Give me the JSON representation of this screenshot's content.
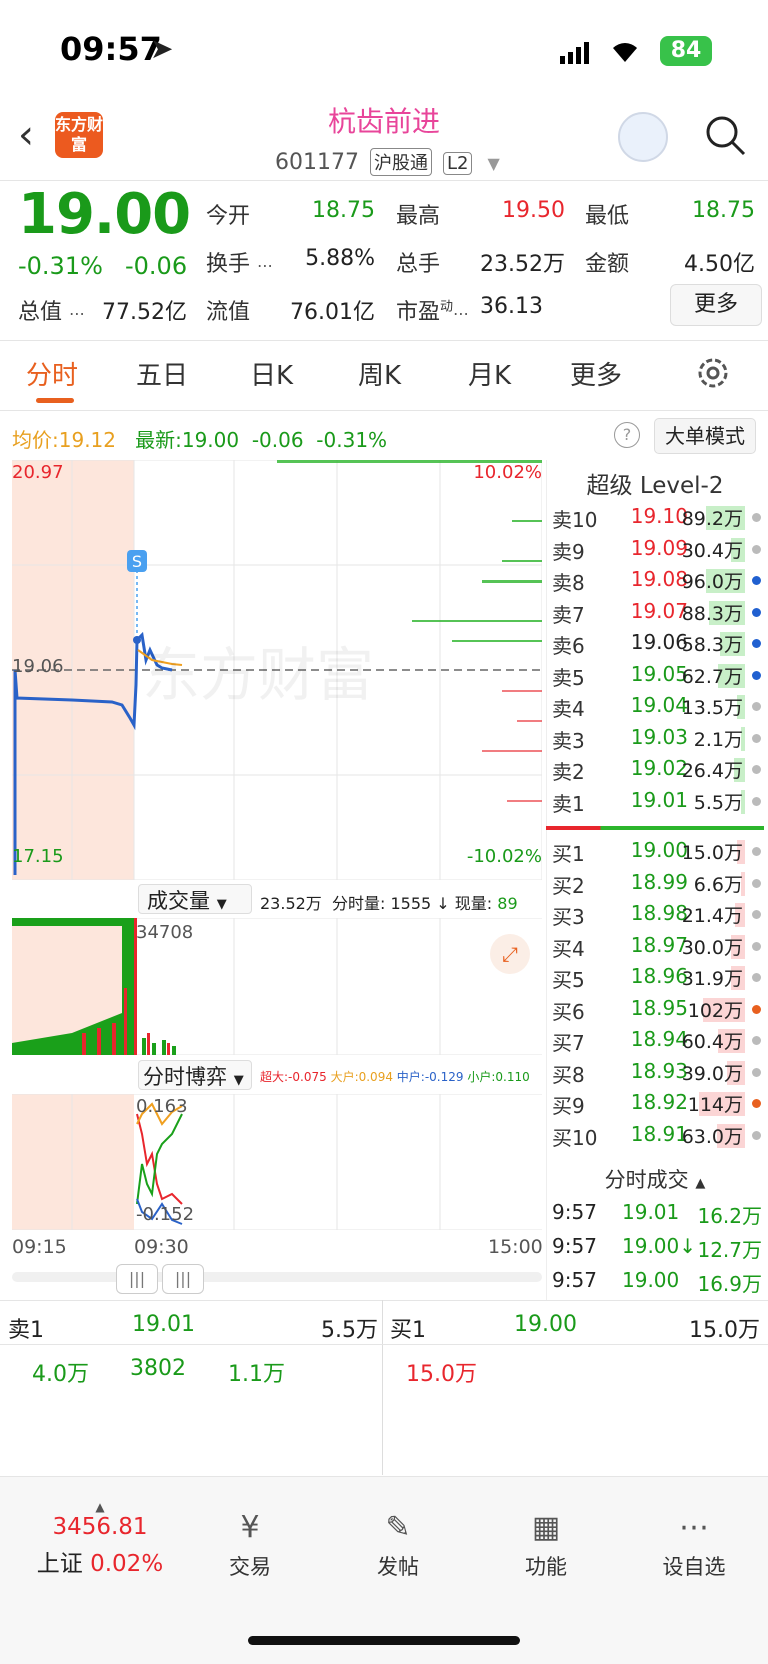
{
  "status_bar": {
    "time": "09:57",
    "battery": "84"
  },
  "header": {
    "logo_text": "东方财富",
    "title": "杭齿前进",
    "code": "601177",
    "tag1": "沪股通",
    "tag2": "L2"
  },
  "quote": {
    "price": "19.00",
    "change_pct": "-0.31%",
    "change": "-0.06",
    "rows": [
      [
        {
          "label": "今开",
          "value": "18.75",
          "color": "green"
        },
        {
          "label": "最高",
          "value": "19.50",
          "color": "red"
        },
        {
          "label": "最低",
          "value": "18.75",
          "color": "green"
        }
      ],
      [
        {
          "label": "换手",
          "value": "5.88%",
          "color": "black"
        },
        {
          "label": "总手",
          "value": "23.52万",
          "color": "black"
        },
        {
          "label": "金额",
          "value": "4.50亿",
          "color": "black"
        }
      ],
      [
        {
          "label": "流值",
          "value": "76.01亿",
          "color": "black"
        },
        {
          "label": "市盈",
          "value": "36.13",
          "color": "black"
        }
      ]
    ],
    "total_value_label": "总值",
    "total_value": "77.52亿",
    "pe_sup": "动",
    "more_label": "更多"
  },
  "tabs": [
    "分时",
    "五日",
    "日K",
    "周K",
    "月K",
    "更多"
  ],
  "info_line": {
    "avg_label": "均价:",
    "avg": "19.12",
    "latest_label": "最新:",
    "latest": "19.00",
    "chg": "-0.06",
    "pct": "-0.31%",
    "mode_label": "大单模式"
  },
  "chart_data": {
    "type": "line",
    "y_max": "20.97",
    "y_min": "17.15",
    "y_mid": "19.06",
    "pct_max": "10.02%",
    "pct_min": "-10.02%",
    "x_labels": [
      "09:15",
      "09:30",
      "15:00"
    ],
    "marker": "S",
    "watermark": "东方财富"
  },
  "volume_panel": {
    "title": "成交量",
    "total": "23.52万",
    "fen_label": "分时量:",
    "fen": "1555",
    "now_label": "现量:",
    "now": "89",
    "peak": "34708"
  },
  "game_panel": {
    "title": "分时博弈",
    "super_label": "超大:",
    "super": "-0.075",
    "big_label": "大户:",
    "big": "0.094",
    "mid_label": "中户:",
    "mid": "-0.129",
    "small_label": "小户:",
    "small": "0.110",
    "top": "0.163",
    "bottom": "-0.152"
  },
  "orderbook": {
    "title": "超级 Level-2",
    "asks": [
      {
        "label": "卖10",
        "price": "19.10",
        "vol": "89.2万",
        "pcolor": "red",
        "bar": 0.55,
        "dot": "#bbb"
      },
      {
        "label": "卖9",
        "price": "19.09",
        "vol": "30.4万",
        "pcolor": "red",
        "bar": 0.2,
        "dot": "#bbb"
      },
      {
        "label": "卖8",
        "price": "19.08",
        "vol": "96.0万",
        "pcolor": "red",
        "bar": 0.55,
        "dot": "#2060d0"
      },
      {
        "label": "卖7",
        "price": "19.07",
        "vol": "88.3万",
        "pcolor": "red",
        "bar": 0.52,
        "dot": "#2060d0"
      },
      {
        "label": "卖6",
        "price": "19.06",
        "vol": "58.3万",
        "pcolor": "black",
        "bar": 0.35,
        "dot": "#2060d0"
      },
      {
        "label": "卖5",
        "price": "19.05",
        "vol": "62.7万",
        "pcolor": "green",
        "bar": 0.38,
        "dot": "#2060d0"
      },
      {
        "label": "卖4",
        "price": "19.04",
        "vol": "13.5万",
        "pcolor": "green",
        "bar": 0.12,
        "dot": "#bbb"
      },
      {
        "label": "卖3",
        "price": "19.03",
        "vol": "2.1万",
        "pcolor": "green",
        "bar": 0.05,
        "dot": "#bbb"
      },
      {
        "label": "卖2",
        "price": "19.02",
        "vol": "26.4万",
        "pcolor": "green",
        "bar": 0.15,
        "dot": "#bbb"
      },
      {
        "label": "卖1",
        "price": "19.01",
        "vol": "5.5万",
        "pcolor": "green",
        "bar": 0.06,
        "dot": "#bbb"
      }
    ],
    "bids": [
      {
        "label": "买1",
        "price": "19.00",
        "vol": "15.0万",
        "pcolor": "green",
        "bar": 0.12,
        "dot": "#bbb"
      },
      {
        "label": "买2",
        "price": "18.99",
        "vol": "6.6万",
        "pcolor": "green",
        "bar": 0.06,
        "dot": "#bbb"
      },
      {
        "label": "买3",
        "price": "18.98",
        "vol": "21.4万",
        "pcolor": "green",
        "bar": 0.14,
        "dot": "#bbb"
      },
      {
        "label": "买4",
        "price": "18.97",
        "vol": "30.0万",
        "pcolor": "green",
        "bar": 0.2,
        "dot": "#bbb"
      },
      {
        "label": "买5",
        "price": "18.96",
        "vol": "31.9万",
        "pcolor": "green",
        "bar": 0.2,
        "dot": "#bbb"
      },
      {
        "label": "买6",
        "price": "18.95",
        "vol": "102万",
        "pcolor": "green",
        "bar": 0.6,
        "dot": "#e8601f"
      },
      {
        "label": "买7",
        "price": "18.94",
        "vol": "60.4万",
        "pcolor": "green",
        "bar": 0.38,
        "dot": "#bbb"
      },
      {
        "label": "买8",
        "price": "18.93",
        "vol": "39.0万",
        "pcolor": "green",
        "bar": 0.25,
        "dot": "#bbb"
      },
      {
        "label": "买9",
        "price": "18.92",
        "vol": "114万",
        "pcolor": "green",
        "bar": 0.65,
        "dot": "#e8601f"
      },
      {
        "label": "买10",
        "price": "18.91",
        "vol": "63.0万",
        "pcolor": "green",
        "bar": 0.4,
        "dot": "#bbb"
      }
    ]
  },
  "trades": {
    "title": "分时成交",
    "rows": [
      {
        "time": "9:57",
        "price": "19.01",
        "vol": "16.2万",
        "pcolor": "green"
      },
      {
        "time": "9:57",
        "price": "19.00↓",
        "vol": "12.7万",
        "pcolor": "green"
      },
      {
        "time": "9:57",
        "price": "19.00",
        "vol": "16.9万",
        "pcolor": "green"
      }
    ]
  },
  "bottom_quote": {
    "left_label": "卖1",
    "left_price": "19.01",
    "left_vol": "5.5万",
    "left_items": [
      "4.0万",
      "3802",
      "1.1万"
    ],
    "right_label": "买1",
    "right_price": "19.00",
    "right_vol": "15.0万",
    "right_items": [
      "15.0万"
    ]
  },
  "bottom_nav": {
    "index_value": "3456.81",
    "index_name": "上证",
    "index_pct": "0.02%",
    "items": [
      {
        "label": "交易",
        "icon": "¥"
      },
      {
        "label": "发帖",
        "icon": "✎"
      },
      {
        "label": "功能",
        "icon": "▦"
      },
      {
        "label": "设自选",
        "icon": "⋯"
      }
    ]
  }
}
